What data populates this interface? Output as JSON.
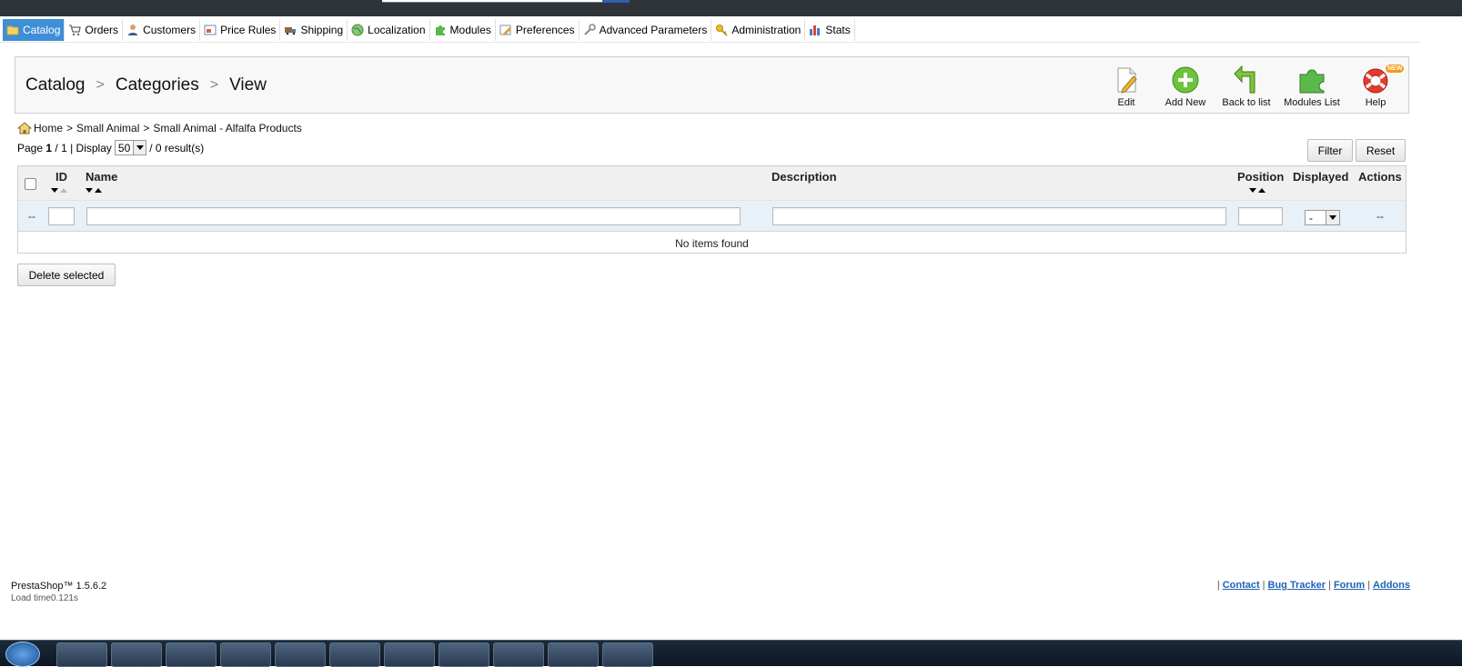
{
  "menu": {
    "items": [
      {
        "label": "Catalog",
        "icon": "folder-icon"
      },
      {
        "label": "Orders",
        "icon": "cart-icon"
      },
      {
        "label": "Customers",
        "icon": "user-icon"
      },
      {
        "label": "Price Rules",
        "icon": "price-tag-icon"
      },
      {
        "label": "Shipping",
        "icon": "truck-icon"
      },
      {
        "label": "Localization",
        "icon": "globe-icon"
      },
      {
        "label": "Modules",
        "icon": "puzzle-icon"
      },
      {
        "label": "Preferences",
        "icon": "preferences-icon"
      },
      {
        "label": "Advanced Parameters",
        "icon": "wrench-icon"
      },
      {
        "label": "Administration",
        "icon": "key-icon"
      },
      {
        "label": "Stats",
        "icon": "bar-chart-icon"
      }
    ]
  },
  "page_title": {
    "part1": "Catalog",
    "part2": "Categories",
    "part3": "View",
    "separator": ">"
  },
  "toolbar": {
    "edit": "Edit",
    "add_new": "Add New",
    "back_to_list": "Back to list",
    "modules_list": "Modules List",
    "help": "Help",
    "help_badge": "NEW"
  },
  "breadcrumb": {
    "home": "Home",
    "item1": "Small Animal",
    "item2": "Small Animal - Alfalfa Products",
    "separator": ">"
  },
  "pagination": {
    "page_label": "Page",
    "current_page": "1",
    "total_pages": "/ 1",
    "display_label": "| Display",
    "per_page": "50",
    "results": "/ 0 result(s)"
  },
  "buttons": {
    "filter": "Filter",
    "reset": "Reset",
    "delete_selected": "Delete selected"
  },
  "table": {
    "columns": {
      "id": "ID",
      "name": "Name",
      "description": "Description",
      "position": "Position",
      "displayed": "Displayed",
      "actions": "Actions"
    },
    "filter_row": {
      "checkbox_placeholder": "--",
      "displayed_value": "-",
      "actions_placeholder": "--"
    },
    "empty_message": "No items found"
  },
  "footer": {
    "version": "PrestaShop™ 1.5.6.2",
    "load_time": "Load time0.121s",
    "links": [
      "Contact",
      "Bug Tracker",
      "Forum",
      "Addons"
    ]
  },
  "colors": {
    "active_tab": "#3e8ed8",
    "top_bar": "#2f3439",
    "link": "#1e63b4"
  }
}
